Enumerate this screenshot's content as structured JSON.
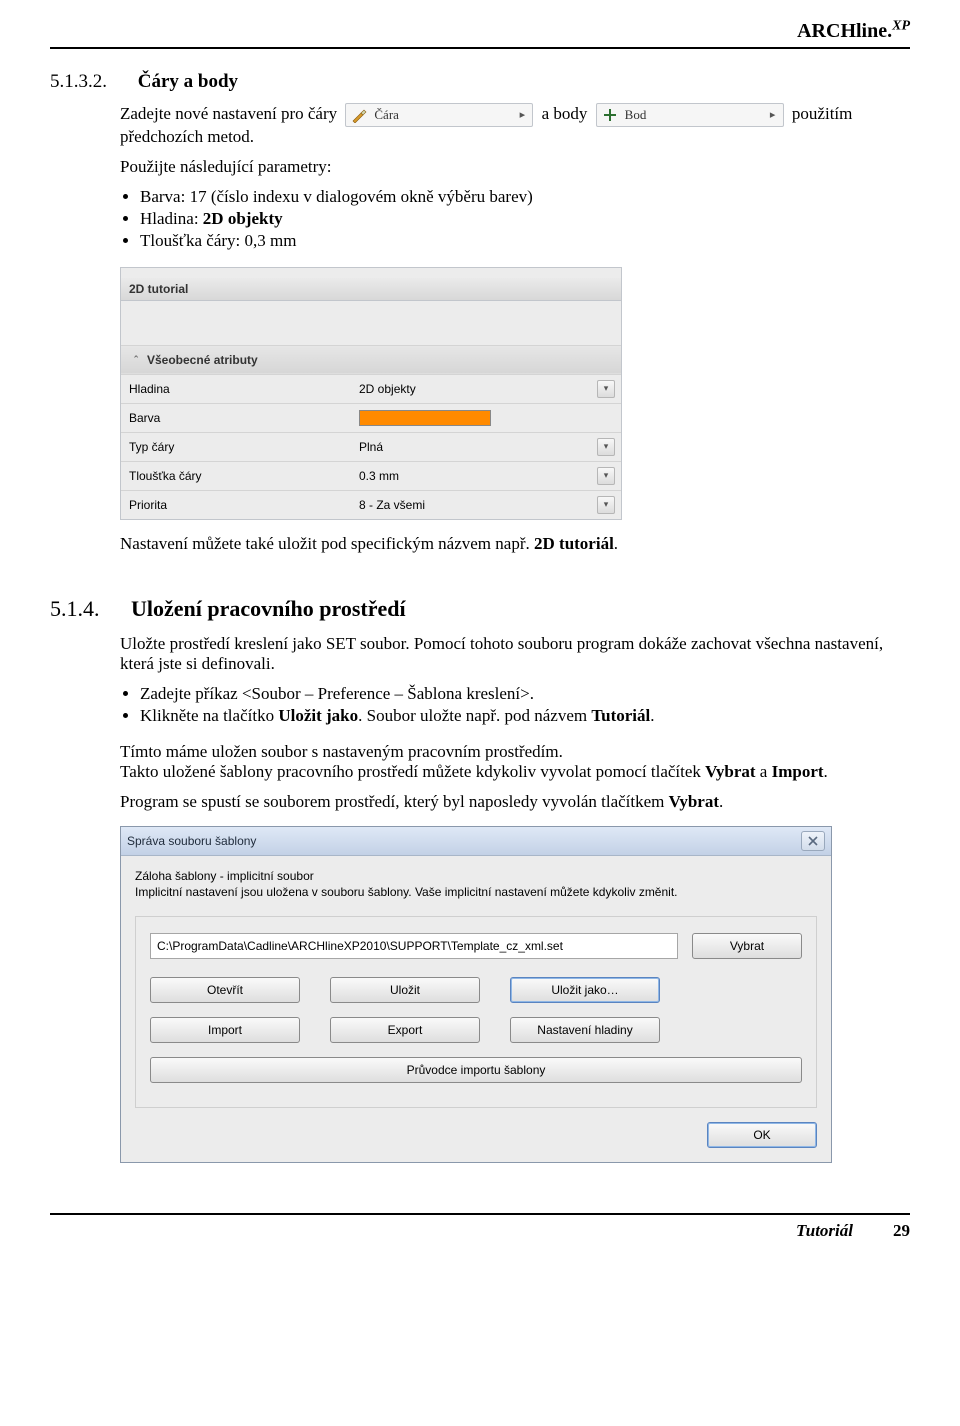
{
  "brand": "ARCHline.",
  "brand_sup": "XP",
  "s1": {
    "num": "5.1.3.2.",
    "title": "Čáry a body",
    "p1a": "Zadejte nové nastavení pro čáry",
    "p1b": "a body",
    "p1c": "použitím předchozích metod.",
    "tool1": {
      "label": "Čára"
    },
    "tool2": {
      "label": "Bod"
    },
    "p2": "Použijte následující parametry:",
    "b1": "Barva: 17 (číslo indexu v dialogovém okně výběru barev)",
    "b2a": "Hladina: ",
    "b2b": "2D objekty",
    "b3": "Tloušťka čáry: 0,3 mm"
  },
  "panel": {
    "tab_title": "2D tutorial",
    "section_title": "Všeobecné atributy",
    "rows": {
      "hladina_l": "Hladina",
      "hladina_v": "2D objekty",
      "barva_l": "Barva",
      "barva_color": "#ff8a00",
      "typ_l": "Typ čáry",
      "typ_v": "Plná",
      "tl_l": "Tloušťka čáry",
      "tl_v": "0.3 mm",
      "pri_l": "Priorita",
      "pri_v": "8 - Za všemi"
    }
  },
  "after_panel_a": "Nastavení můžete také uložit pod specifickým názvem např. ",
  "after_panel_b": "2D tutoriál",
  "after_panel_c": ".",
  "s2": {
    "num": "5.1.4.",
    "title": "Uložení pracovního prostředí",
    "p1": "Uložte prostředí kreslení jako SET soubor. Pomocí tohoto souboru program dokáže zachovat všechna nastavení, která jste si definovali.",
    "b1": "Zadejte příkaz <Soubor – Preference – Šablona kreslení>.",
    "b2a": "Klikněte na tlačítko ",
    "b2b": "Uložit jako",
    "b2c": ". Soubor uložte např. pod názvem ",
    "b2d": "Tutoriál",
    "b2e": ".",
    "p2a": "Tímto máme uložen soubor s nastaveným pracovním prostředím.",
    "p2b_a": "Takto uložené šablony pracovního prostředí můžete kdykoliv vyvolat pomocí tlačítek ",
    "p2b_b": "Vybrat",
    "p2b_c": " a ",
    "p2b_d": "Import",
    "p2b_e": ".",
    "p3a": "Program se spustí se souborem prostředí, který byl naposledy vyvolán tlačítkem ",
    "p3b": "Vybrat",
    "p3c": "."
  },
  "dlg": {
    "title": "Správa souboru šablony",
    "desc1": "Záloha šablony - implicitní soubor",
    "desc2": "Implicitní nastavení jsou uložena v souboru šablony. Vaše implicitní nastavení můžete kdykoliv změnit.",
    "path": "C:\\ProgramData\\Cadline\\ARCHlineXP2010\\SUPPORT\\Template_cz_xml.set",
    "vybrat": "Vybrat",
    "otevrit": "Otevřít",
    "ulozit": "Uložit",
    "ulozit_jako": "Uložit jako…",
    "import": "Import",
    "export": "Export",
    "nast_hlad": "Nastavení hladiny",
    "pruvodce": "Průvodce importu šablony",
    "ok": "OK"
  },
  "footer": {
    "name": "Tutoriál",
    "page": "29"
  }
}
